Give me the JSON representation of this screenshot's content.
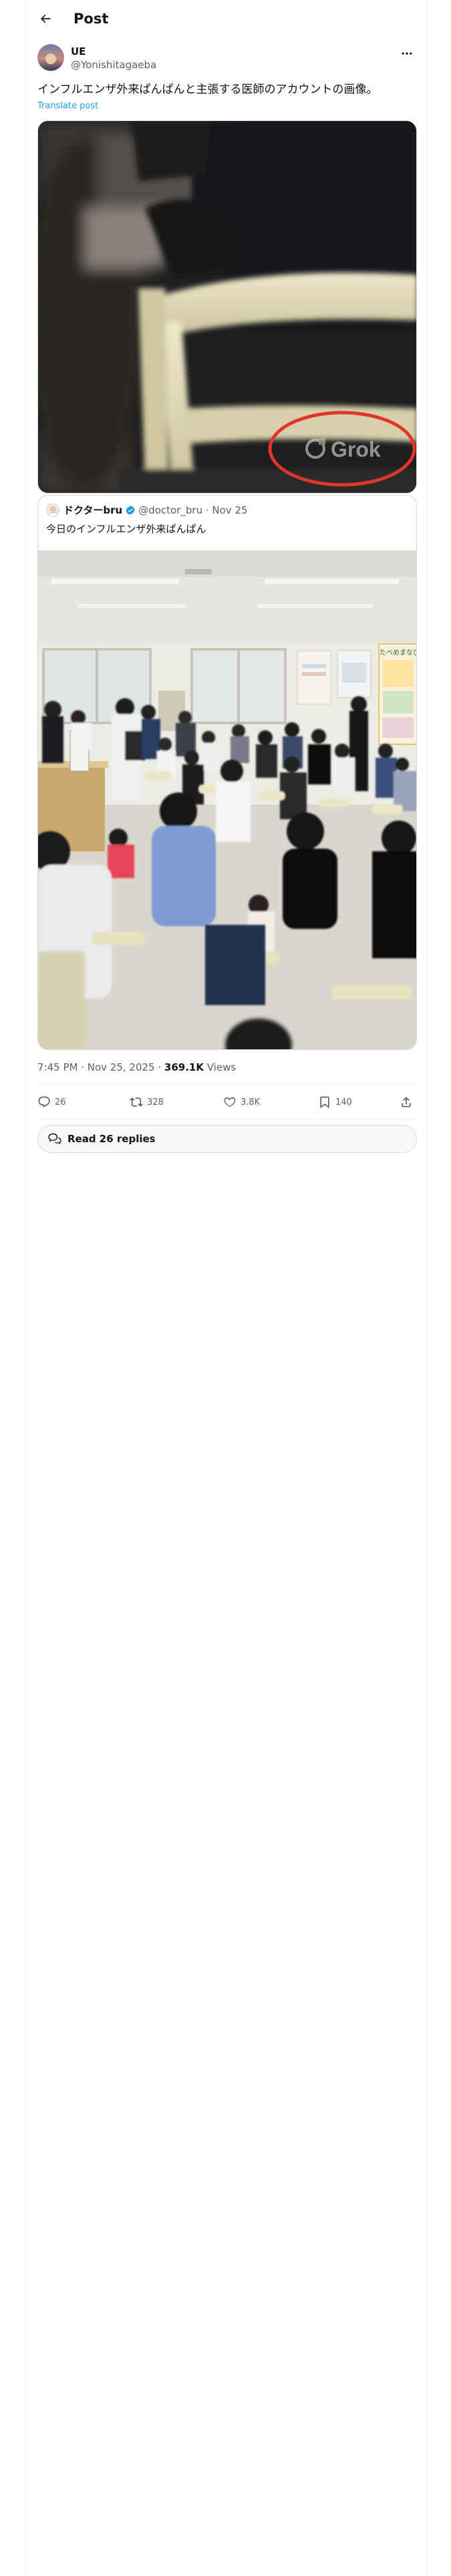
{
  "header": {
    "title": "Post",
    "back_icon": "arrow-left-icon"
  },
  "author": {
    "name": "UE",
    "handle": "@Yonishitagaeba"
  },
  "tweet": {
    "text": "インフルエンザ外来ぱんぱんと主張する医師のアカウントの画像。",
    "translate_label": "Translate post",
    "image_watermark": "Grok"
  },
  "quote": {
    "name": "ドクターbru",
    "handle": "@doctor_bru",
    "date": "Nov 25",
    "text": "今日のインフルエンザ外来ぱんぱん",
    "poster_text": "たべめまなびまご"
  },
  "meta": {
    "time": "7:45 PM · Nov 25, 2025 · ",
    "views_count": "369.1K",
    "views_label": " Views"
  },
  "actions": {
    "replies": "26",
    "reposts": "328",
    "likes": "3.8K",
    "bookmarks": "140"
  },
  "read_replies": "Read 26 replies",
  "colors": {
    "accent": "#1d9bf0",
    "muted": "#536471",
    "circle": "#e0352b"
  }
}
